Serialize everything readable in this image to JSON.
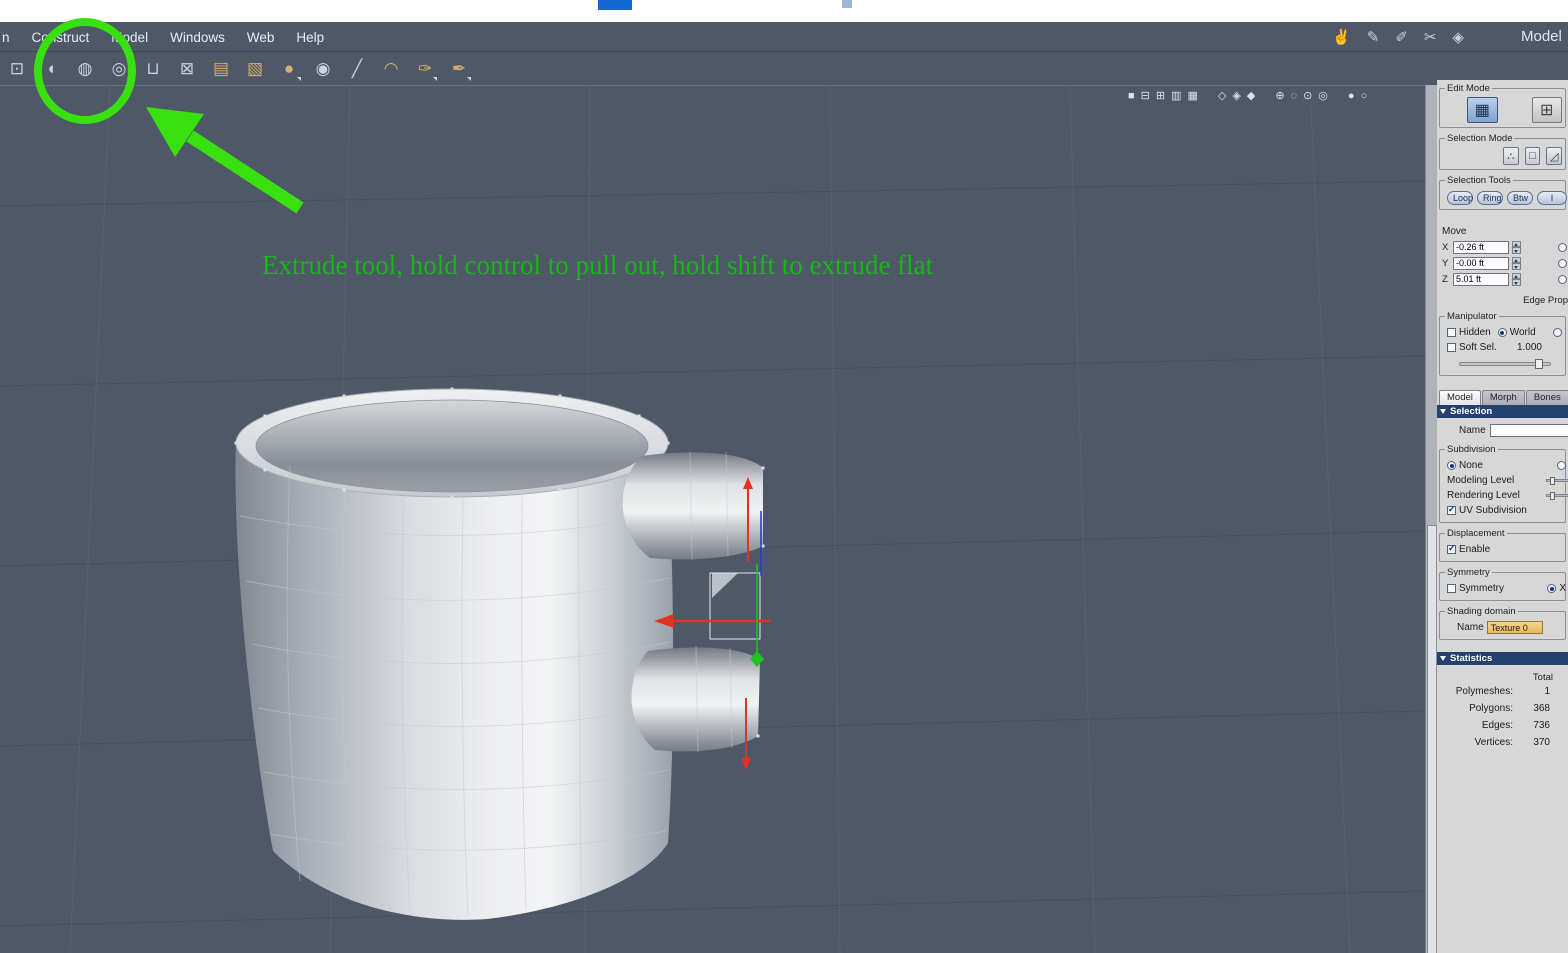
{
  "window": {
    "room_label": "Model"
  },
  "menu": {
    "items": [
      {
        "label": "n"
      },
      {
        "label": "Construct"
      },
      {
        "label": "Model"
      },
      {
        "label": "Windows"
      },
      {
        "label": "Web"
      },
      {
        "label": "Help"
      }
    ]
  },
  "menubar_icons": [
    {
      "name": "hand-tool-icon",
      "glyph": "✌"
    },
    {
      "name": "pencil-tool-icon",
      "glyph": "✎"
    },
    {
      "name": "pen-tool-icon",
      "glyph": "✐"
    },
    {
      "name": "knife-tool-icon",
      "glyph": "✂"
    },
    {
      "name": "uv-view-icon",
      "glyph": "◈"
    }
  ],
  "toolbar": {
    "icons": [
      {
        "name": "select-tool-icon",
        "glyph": "⊡"
      },
      {
        "name": "dome-tool-icon",
        "glyph": "◖"
      },
      {
        "name": "extrude-tool-icon",
        "glyph": "◍"
      },
      {
        "name": "bridge-tool-icon",
        "glyph": "◎"
      },
      {
        "name": "shell-tool-icon",
        "glyph": "⊔"
      },
      {
        "name": "delete-tool-icon",
        "glyph": "⊠"
      },
      {
        "name": "smooth-tool-icon",
        "glyph": "▤"
      },
      {
        "name": "tessellate-tool-icon",
        "glyph": "▧"
      },
      {
        "name": "clay-tool-icon",
        "glyph": "●"
      },
      {
        "name": "magnet-tool-icon",
        "glyph": "◉"
      },
      {
        "name": "line-tool-icon",
        "glyph": "╱"
      },
      {
        "name": "bend-tool-icon",
        "glyph": "◠"
      },
      {
        "name": "curve-tool-icon",
        "glyph": "✑"
      },
      {
        "name": "pen-nib-tool-icon",
        "glyph": "✒"
      }
    ]
  },
  "viewport": {
    "view_icons": [
      {
        "name": "layout-single-view-icon",
        "glyph": "■"
      },
      {
        "name": "layout-two-pane-icon",
        "glyph": "⊟"
      },
      {
        "name": "layout-four-pane-icon",
        "glyph": "⊞"
      },
      {
        "name": "layout-three-pane-icon",
        "glyph": "▥"
      },
      {
        "name": "layout-grid-icon",
        "glyph": "▦"
      },
      {
        "name": "wireframe-shade-icon",
        "glyph": "◇"
      },
      {
        "name": "flat-shade-icon",
        "glyph": "◈"
      },
      {
        "name": "smooth-shade-icon",
        "glyph": "◆"
      },
      {
        "name": "camera-orbit-icon",
        "glyph": "⊕"
      },
      {
        "name": "camera-pan-icon",
        "glyph": "◌"
      },
      {
        "name": "camera-dolly-icon",
        "glyph": "⊙"
      },
      {
        "name": "camera-reset-icon",
        "glyph": "◎"
      },
      {
        "name": "preview-ball-icon",
        "glyph": "●"
      },
      {
        "name": "preview-ball-outline-icon",
        "glyph": "○"
      }
    ]
  },
  "annotation": {
    "text": "Extrude tool, hold control to pull out, hold shift to extrude flat",
    "text_color": "#15b815",
    "marker_color": "#38e010"
  },
  "right_panel": {
    "edit_mode": {
      "title": "Edit Mode",
      "buttons": [
        {
          "glyph": "▦"
        },
        {
          "glyph": "⊞"
        }
      ]
    },
    "selection_mode": {
      "title": "Selection Mode",
      "buttons": [
        {
          "glyph": "∴"
        },
        {
          "glyph": "□"
        },
        {
          "glyph": "◿"
        }
      ]
    },
    "selection_tools": {
      "title": "Selection Tools",
      "buttons": [
        "Loop",
        "Ring",
        "Btw",
        "I"
      ]
    },
    "move": {
      "title": "Move",
      "fields": [
        {
          "axis": "X",
          "value": "-0.26 ft"
        },
        {
          "axis": "Y",
          "value": "-0.00 ft"
        },
        {
          "axis": "Z",
          "value": "5.01 ft"
        }
      ],
      "edge_prop_label": "Edge Prop"
    },
    "manipulator": {
      "title": "Manipulator",
      "hidden_label": "Hidden",
      "world_label": "World",
      "soft_sel_label": "Soft Sel.",
      "soft_sel_value": "1.000"
    },
    "tabs": [
      {
        "label": "Model",
        "active": true
      },
      {
        "label": "Morph",
        "active": false
      },
      {
        "label": "Bones",
        "active": false
      }
    ],
    "selection_section": {
      "title": "Selection",
      "name_label": "Name",
      "name_value": "",
      "subdivision_title": "Subdivision",
      "none_label": "None",
      "modeling_level_label": "Modeling Level",
      "rendering_level_label": "Rendering Level",
      "uv_subdivision_label": "UV Subdivision",
      "displacement_title": "Displacement",
      "enable_label": "Enable",
      "symmetry_title": "Symmetry",
      "symmetry_label": "Symmetry",
      "symmetry_axis_label": "X",
      "shading_title": "Shading domain",
      "shading_name_label": "Name",
      "shading_value": "Texture 0"
    },
    "statistics": {
      "title": "Statistics",
      "total_label": "Total",
      "rows": [
        {
          "label": "Polymeshes:",
          "value": "1"
        },
        {
          "label": "Polygons:",
          "value": "368"
        },
        {
          "label": "Edges:",
          "value": "736"
        },
        {
          "label": "Vertices:",
          "value": "370"
        }
      ]
    }
  }
}
